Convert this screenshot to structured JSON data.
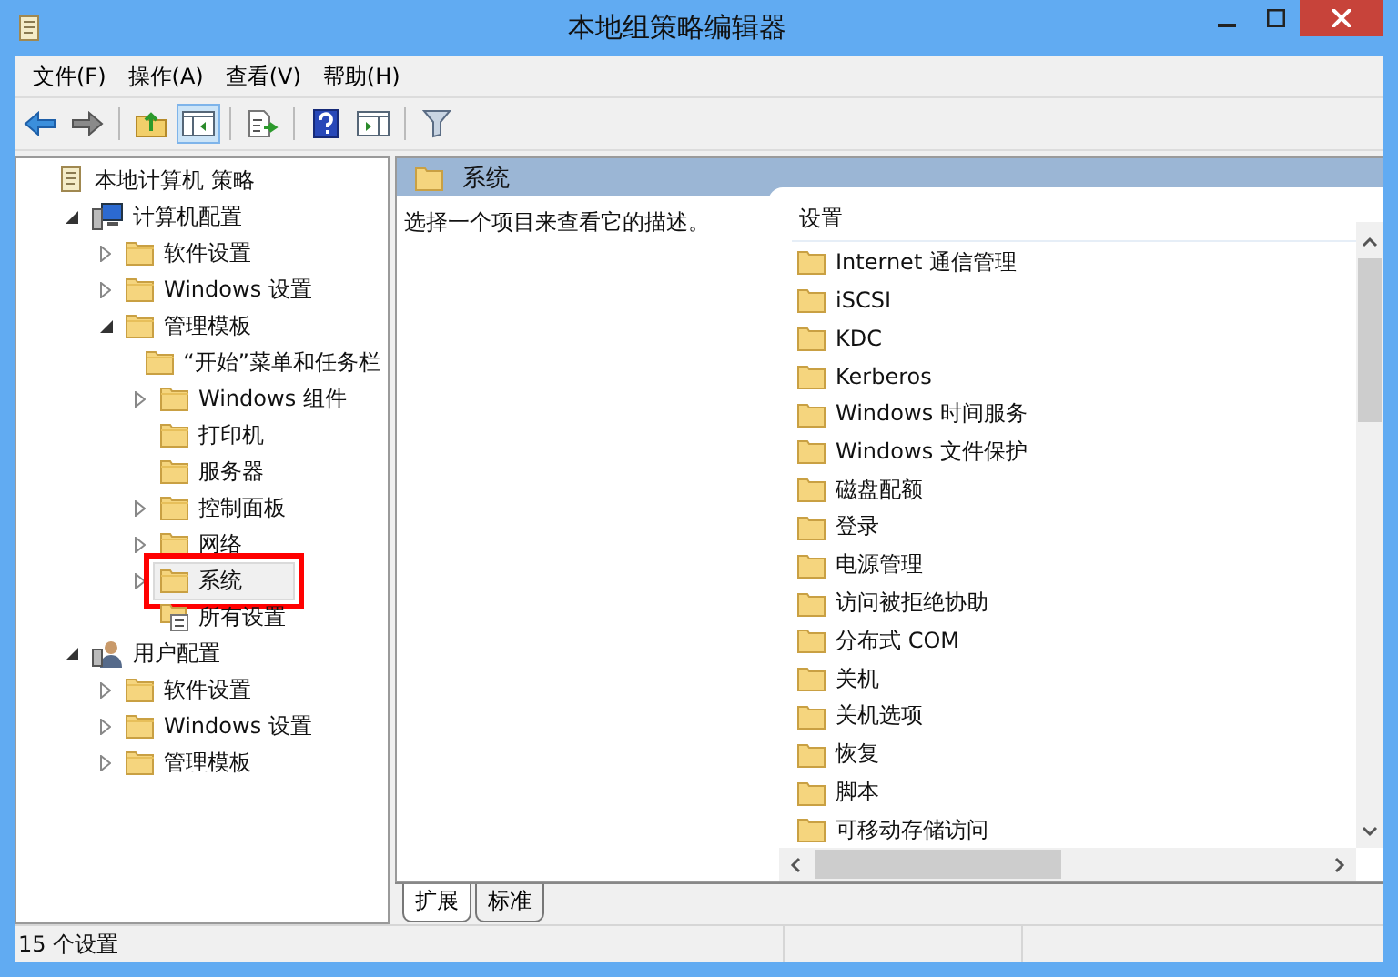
{
  "window": {
    "title": "本地组策略编辑器"
  },
  "menu": [
    "文件(F)",
    "操作(A)",
    "查看(V)",
    "帮助(H)"
  ],
  "toolbar": [
    [
      {
        "kind": "back",
        "pressed": false
      },
      {
        "kind": "forward",
        "pressed": false
      }
    ],
    [
      {
        "kind": "up",
        "pressed": false
      },
      {
        "kind": "tree",
        "pressed": true
      }
    ],
    [
      {
        "kind": "export",
        "pressed": false
      }
    ],
    [
      {
        "kind": "help",
        "pressed": false
      },
      {
        "kind": "pane",
        "pressed": false
      }
    ],
    [
      {
        "kind": "filter",
        "pressed": false
      }
    ]
  ],
  "tree": [
    {
      "label": "本地计算机 策略",
      "kind": "policy",
      "selected": false,
      "highlighted": false,
      "children": [
        {
          "label": "计算机配置",
          "kind": "computer",
          "expanded": true,
          "selected": false,
          "highlighted": false,
          "children": [
            {
              "label": "软件设置",
              "kind": "folder",
              "expanded": false,
              "selected": false,
              "highlighted": false
            },
            {
              "label": "Windows 设置",
              "kind": "folder",
              "expanded": false,
              "selected": false,
              "highlighted": false
            },
            {
              "label": "管理模板",
              "kind": "folder",
              "expanded": true,
              "selected": false,
              "highlighted": false,
              "children": [
                {
                  "label": "“开始”菜单和任务栏",
                  "kind": "folder",
                  "selected": false,
                  "highlighted": false
                },
                {
                  "label": "Windows 组件",
                  "kind": "folder",
                  "expanded": false,
                  "selected": false,
                  "highlighted": false
                },
                {
                  "label": "打印机",
                  "kind": "folder",
                  "selected": false,
                  "highlighted": false
                },
                {
                  "label": "服务器",
                  "kind": "folder",
                  "selected": false,
                  "highlighted": false
                },
                {
                  "label": "控制面板",
                  "kind": "folder",
                  "expanded": false,
                  "selected": false,
                  "highlighted": false
                },
                {
                  "label": "网络",
                  "kind": "folder",
                  "expanded": false,
                  "selected": false,
                  "highlighted": false
                },
                {
                  "label": "系统",
                  "kind": "folder",
                  "expanded": false,
                  "selected": true,
                  "highlighted": true
                },
                {
                  "label": "所有设置",
                  "kind": "settings",
                  "selected": false,
                  "highlighted": false
                }
              ]
            }
          ]
        },
        {
          "label": "用户配置",
          "kind": "user",
          "expanded": true,
          "selected": false,
          "highlighted": false,
          "children": [
            {
              "label": "软件设置",
              "kind": "folder",
              "expanded": false,
              "selected": false,
              "highlighted": false
            },
            {
              "label": "Windows 设置",
              "kind": "folder",
              "expanded": false,
              "selected": false,
              "highlighted": false
            },
            {
              "label": "管理模板",
              "kind": "folder",
              "expanded": false,
              "selected": false,
              "highlighted": false
            }
          ]
        }
      ]
    }
  ],
  "detail": {
    "title": "系统",
    "description": "选择一个项目来查看它的描述。",
    "column": "设置",
    "items": [
      "Internet 通信管理",
      "iSCSI",
      "KDC",
      "Kerberos",
      "Windows 时间服务",
      "Windows 文件保护",
      "磁盘配额",
      "登录",
      "电源管理",
      "访问被拒绝协助",
      "分布式 COM",
      "关机",
      "关机选项",
      "恢复",
      "脚本",
      "可移动存储访问"
    ]
  },
  "tabs": [
    {
      "label": "扩展",
      "selected": true
    },
    {
      "label": "标准",
      "selected": false
    }
  ],
  "status_bar": "15 个设置"
}
